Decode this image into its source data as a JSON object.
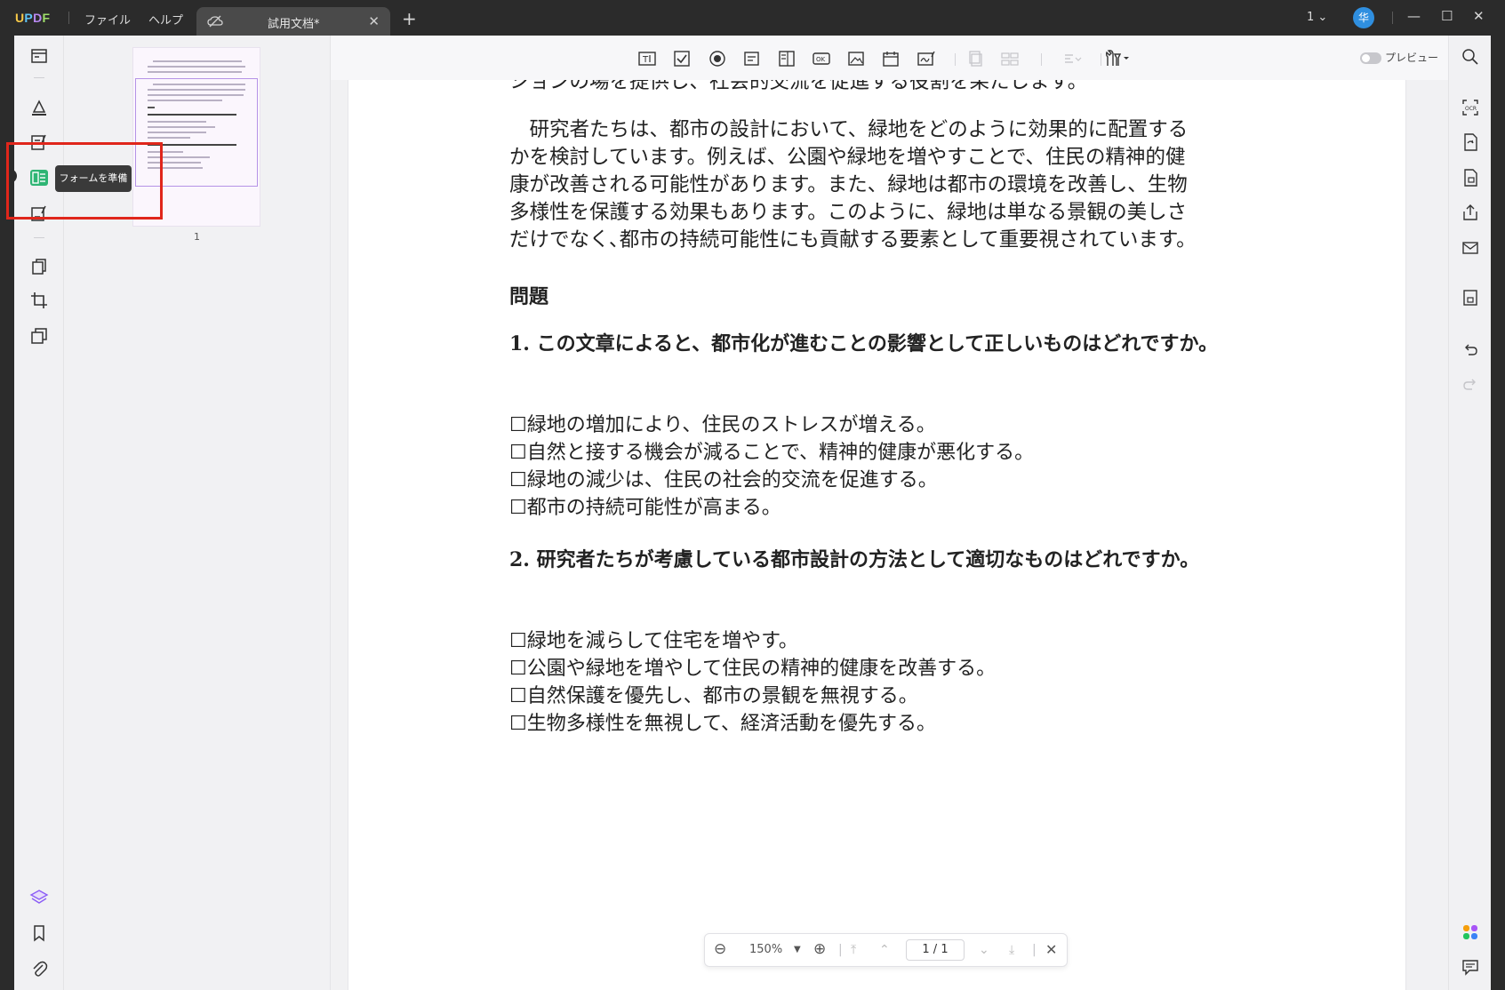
{
  "titlebar": {
    "logo": "UPDF",
    "menu": [
      "ファイル",
      "ヘルプ"
    ],
    "tab_title": "試用文档*",
    "page_selector": "1",
    "avatar_letter": "华"
  },
  "tooltip": "フォームを準備",
  "thumbnail": {
    "page_number": "1"
  },
  "toolbar": {
    "preview_label": "プレビュー",
    "ok_label": "OK"
  },
  "zoom": {
    "level": "150%",
    "page_field": "1 / 1"
  },
  "document": {
    "top_partial": "ションの場を提供し、社会的交流を促進する役割を果たします。",
    "paragraph_lines": [
      "　研究者たちは、都市の設計において、緑地をどのように効果的に配置する",
      "かを検討しています。例えば、公園や緑地を増やすことで、住民の精神的健",
      "康が改善される可能性があります。また、緑地は都市の環境を改善し、生物",
      "多様性を保護する効果もあります。このように、緑地は単なる景観の美しさ",
      "だけでなく､都市の持続可能性にも貢献する要素として重要視されています。"
    ],
    "heading": "問題",
    "questions": [
      {
        "text": "1.  この文章によると、都市化が進むことの影響として正しいものはどれですか。",
        "options": [
          "☐緑地の増加により、住民のストレスが増える。",
          "☐自然と接する機会が減ることで、精神的健康が悪化する。",
          "☐緑地の減少は、住民の社会的交流を促進する。",
          "☐都市の持続可能性が高まる。"
        ]
      },
      {
        "text": "2.  研究者たちが考慮している都市設計の方法として適切なものはどれですか。",
        "options": [
          "☐緑地を減らして住宅を増やす。",
          "☐公園や緑地を増やして住民の精神的健康を改善する。",
          "☐自然保護を優先し、都市の景観を無視する。",
          "☐生物多様性を無視して、経済活動を優先する。"
        ]
      }
    ]
  },
  "colors": {
    "highlight": "#e0261b",
    "accent_green": "#2fb574",
    "avatar": "#2f8fe0"
  }
}
